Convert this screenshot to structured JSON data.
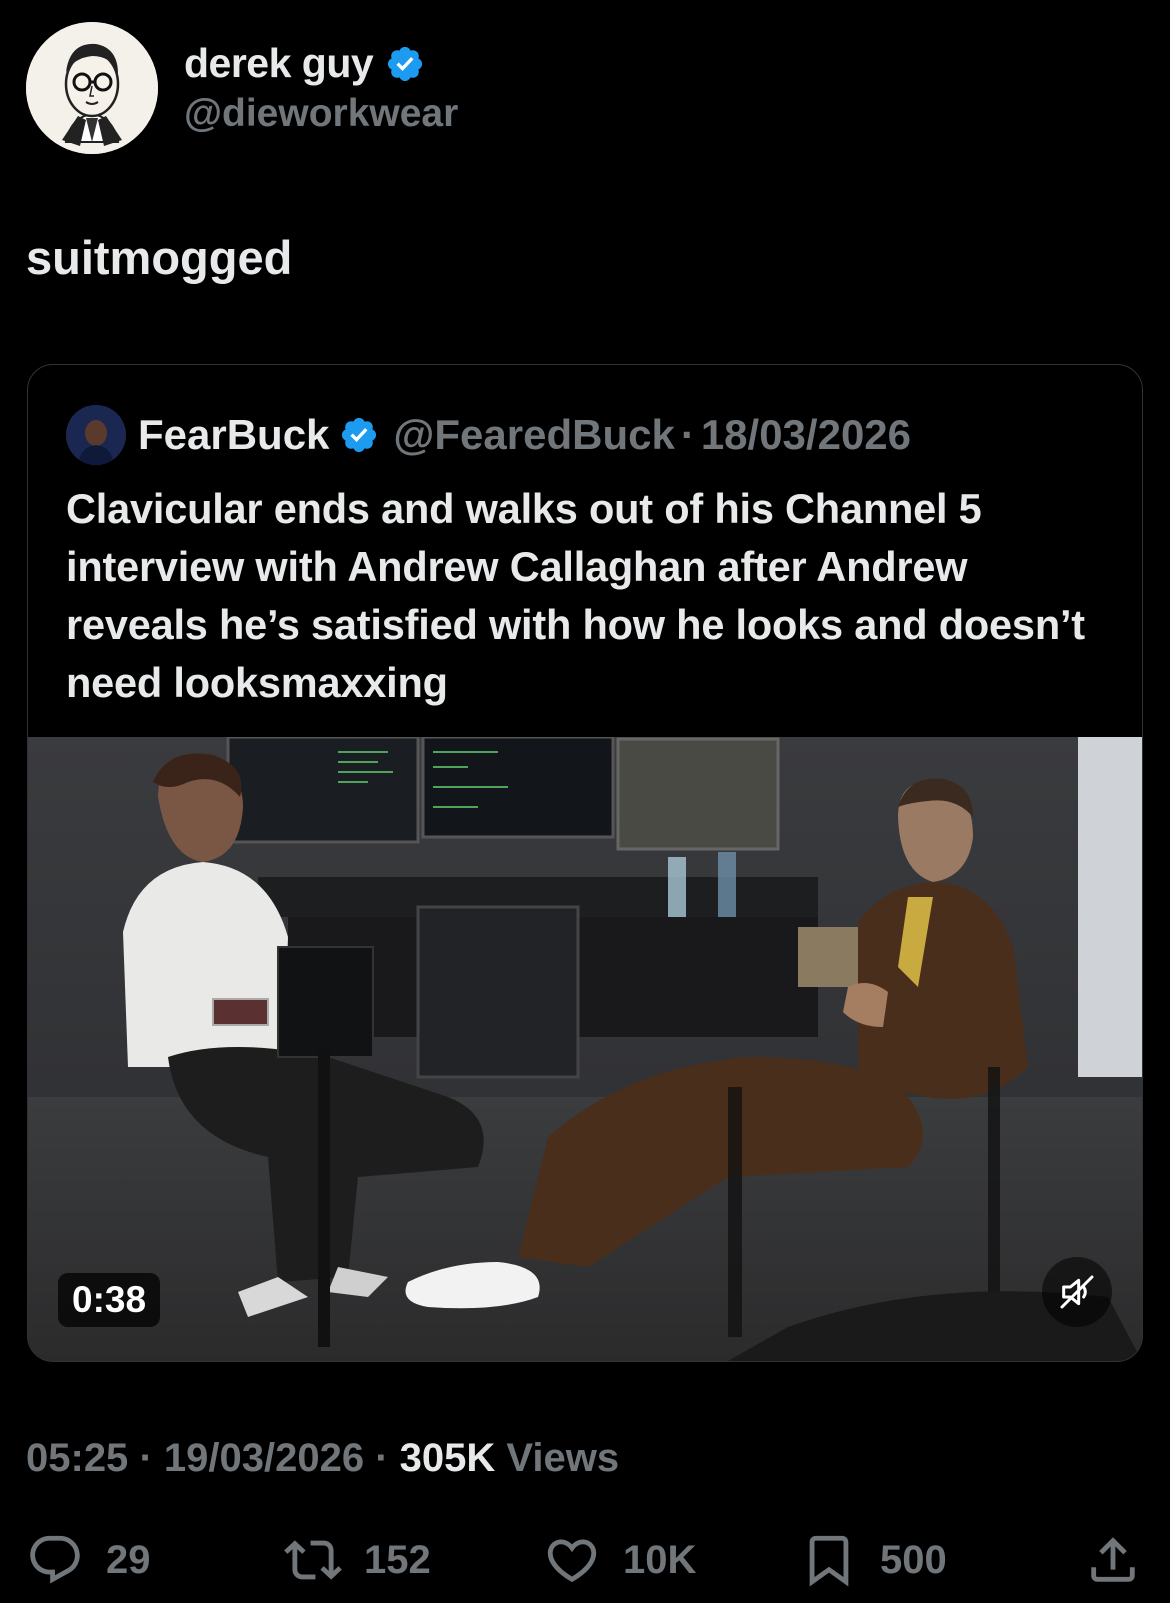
{
  "author": {
    "display_name": "derek guy",
    "handle": "@dieworkwear",
    "verified": true
  },
  "tweet": {
    "text": "suitmogged"
  },
  "quoted": {
    "display_name": "FearBuck",
    "handle": "@FearedBuck",
    "separator": "·",
    "date": "18/03/2026",
    "text": "Clavicular ends and walks out of his Channel 5 interview with Andrew Callaghan after Andrew reveals he’s satisfied with how he looks and doesn’t need looksmaxxing",
    "video": {
      "duration": "0:38",
      "muted": true
    }
  },
  "meta": {
    "time": "05:25",
    "separator": "·",
    "date": "19/03/2026",
    "views_count": "305K",
    "views_label": "Views"
  },
  "actions": {
    "replies": "29",
    "reposts": "152",
    "likes": "10K",
    "bookmarks": "500"
  },
  "colors": {
    "background": "#000000",
    "primary_text": "#e7e9ea",
    "secondary_text": "#71767b",
    "verified_badge": "#1d9bf0",
    "border": "#2f3336"
  }
}
